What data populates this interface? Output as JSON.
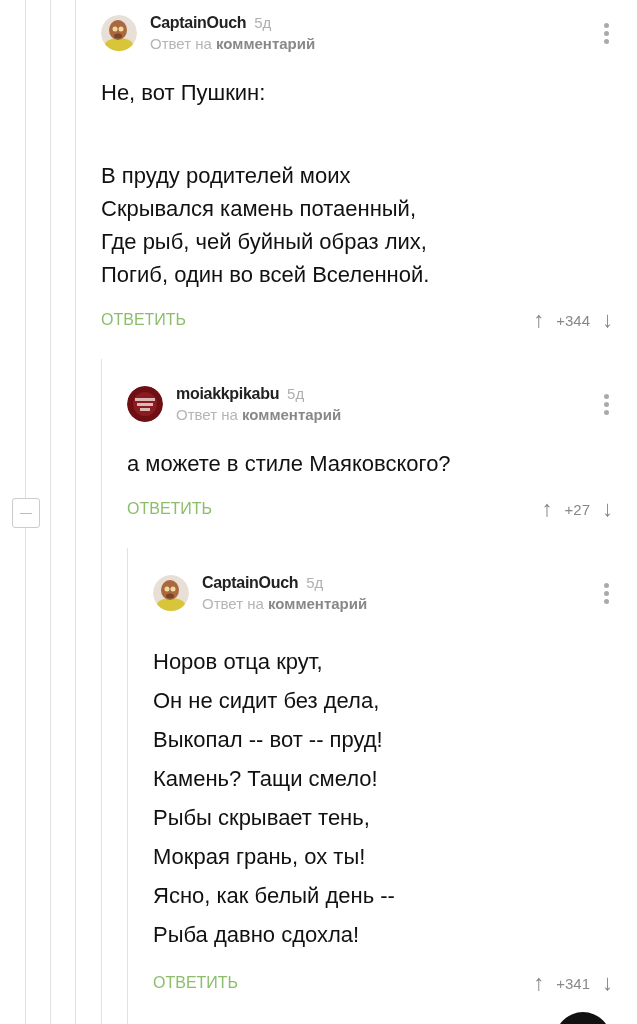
{
  "comments": [
    {
      "author": "CaptainOuch",
      "age": "5д",
      "context": "Ответ на **комментарий**",
      "stanzas": [
        [
          "Не, вот Пушкин:"
        ],
        [
          "В пруду родителей моих",
          "Скрывался камень потаенный,",
          "Где рыб, чей буйный образ лих,",
          "Погиб, один во всей Вселенной."
        ]
      ],
      "reply": "ОТВЕТИТЬ",
      "up": "↑",
      "score": "+344",
      "down": "↓",
      "children": [
        {
          "author": "moiakkpikabu",
          "age": "5д",
          "context": "Ответ на **комментарий**",
          "stanzas": [
            [
              "а можете в стиле Маяковского?"
            ]
          ],
          "reply": "ОТВЕТИТЬ",
          "up": "↑",
          "score": "+27",
          "down": "↓",
          "children": [
            {
              "author": "CaptainOuch",
              "age": "5д",
              "context": "Ответ на **комментарий**",
              "stanzas": [
                [
                  "Норов отца крут,",
                  "Он не сидит без дела,",
                  "Выкопал -- вот -- пруд!",
                  "Камень? Тащи смело!",
                  "Рыбы скрывает тень,",
                  "Мокрая грань, ох ты!",
                  "Ясно, как белый день --",
                  "Рыба давно сдохла!"
                ]
              ],
              "reply": "ОТВЕТИТЬ",
              "up": "↑",
              "score": "+341",
              "down": "↓"
            }
          ]
        }
      ]
    }
  ]
}
